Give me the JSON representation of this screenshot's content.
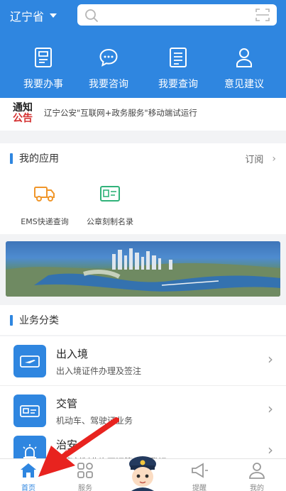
{
  "header": {
    "province": "辽宁省",
    "search_placeholder": "",
    "quick_actions": [
      {
        "label": "我要办事",
        "icon": "form-icon"
      },
      {
        "label": "我要咨询",
        "icon": "chat-icon"
      },
      {
        "label": "我要查询",
        "icon": "list-icon"
      },
      {
        "label": "意见建议",
        "icon": "user-icon"
      }
    ]
  },
  "notice": {
    "badge_line1": "通知",
    "badge_line2": "公告",
    "text": "辽宁公安\"互联网+政务服务\"移动端试运行"
  },
  "my_apps": {
    "title": "我的应用",
    "more_label": "订阅",
    "items": [
      {
        "label": "EMS快递查询",
        "icon": "truck-icon"
      },
      {
        "label": "公章刻制名录",
        "icon": "id-card-icon"
      }
    ]
  },
  "business": {
    "title": "业务分类",
    "items": [
      {
        "title": "出入境",
        "subtitle": "出入境证件办理及签注",
        "icon": "plane-icon"
      },
      {
        "title": "交管",
        "subtitle": "机动车、驾驶证业务",
        "icon": "car-icon"
      },
      {
        "title": "治安",
        "subtitle": "公章刻制业许可证等业务登记",
        "icon": "police-light-icon"
      }
    ]
  },
  "tabbar": {
    "items": [
      {
        "label": "首页",
        "icon": "home-icon",
        "active": true
      },
      {
        "label": "服务",
        "icon": "grid-icon",
        "active": false
      },
      {
        "label": "",
        "icon": "police-avatar-icon",
        "active": false
      },
      {
        "label": "提醒",
        "icon": "megaphone-icon",
        "active": false
      },
      {
        "label": "我的",
        "icon": "person-icon",
        "active": false
      }
    ]
  },
  "colors": {
    "primary": "#2f86e0",
    "notice_red": "#d43030",
    "annotation_arrow": "#e8231f"
  }
}
